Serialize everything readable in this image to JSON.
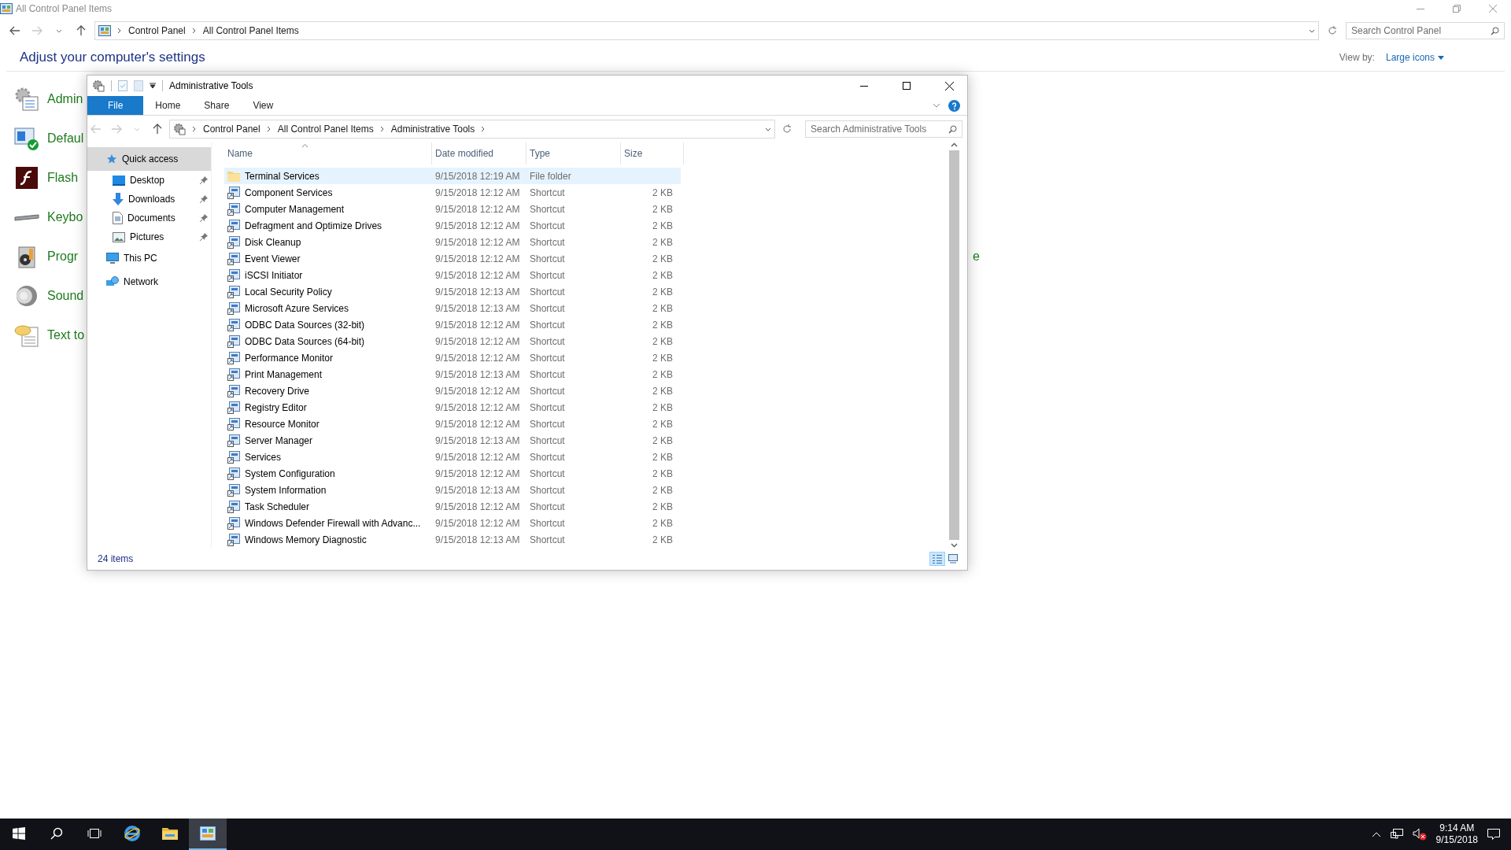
{
  "background_window": {
    "title": "All Control Panel Items",
    "breadcrumb": [
      "Control Panel",
      "All Control Panel Items"
    ],
    "search": {
      "placeholder": "Search Control Panel"
    },
    "heading": "Adjust your computer's settings",
    "view_by": {
      "label": "View by:",
      "value": "Large icons"
    },
    "items": [
      {
        "label": "Admin",
        "kind": "admin"
      },
      {
        "label": "Defaul",
        "kind": "default"
      },
      {
        "label": "Flash",
        "kind": "flash"
      },
      {
        "label": "Keybo",
        "kind": "keyboard"
      },
      {
        "label": "Progr",
        "kind": "programs"
      },
      {
        "label": "Sound",
        "kind": "sound"
      },
      {
        "label": "Text to",
        "kind": "speech"
      }
    ],
    "partial_item": "e"
  },
  "explorer": {
    "title": "Administrative Tools",
    "ribbon_tabs": [
      {
        "label": "File",
        "selected": true
      },
      {
        "label": "Home",
        "selected": false
      },
      {
        "label": "Share",
        "selected": false
      },
      {
        "label": "View",
        "selected": false
      }
    ],
    "breadcrumb": [
      "Control Panel",
      "All Control Panel Items",
      "Administrative Tools"
    ],
    "search": {
      "placeholder": "Search Administrative Tools"
    },
    "nav": [
      {
        "label": "Quick access",
        "kind": "quick_access",
        "selected": true,
        "children": [
          {
            "label": "Desktop",
            "kind": "desktop",
            "selected": false,
            "pinned": true
          },
          {
            "label": "Downloads",
            "kind": "downloads",
            "selected": false,
            "pinned": true
          },
          {
            "label": "Documents",
            "kind": "documents",
            "selected": false,
            "pinned": true
          },
          {
            "label": "Pictures",
            "kind": "pictures",
            "selected": false,
            "pinned": true
          }
        ]
      },
      {
        "label": "This PC",
        "kind": "pc",
        "selected": false
      },
      {
        "label": "Network",
        "kind": "network",
        "selected": false
      }
    ],
    "columns": [
      "Name",
      "Date modified",
      "Type",
      "Size"
    ],
    "rows": [
      {
        "name": "Terminal Services",
        "date": "9/15/2018 12:19 AM",
        "type": "File folder",
        "kind": "folder",
        "selected": true
      },
      {
        "name": "Component Services",
        "date": "9/15/2018 12:12 AM",
        "type": "Shortcut",
        "size": "2 KB",
        "kind": "shortcut",
        "selected": false
      },
      {
        "name": "Computer Management",
        "date": "9/15/2018 12:12 AM",
        "type": "Shortcut",
        "size": "2 KB",
        "kind": "shortcut",
        "selected": false
      },
      {
        "name": "Defragment and Optimize Drives",
        "date": "9/15/2018 12:12 AM",
        "type": "Shortcut",
        "size": "2 KB",
        "kind": "shortcut",
        "selected": false
      },
      {
        "name": "Disk Cleanup",
        "date": "9/15/2018 12:12 AM",
        "type": "Shortcut",
        "size": "2 KB",
        "kind": "shortcut",
        "selected": false
      },
      {
        "name": "Event Viewer",
        "date": "9/15/2018 12:12 AM",
        "type": "Shortcut",
        "size": "2 KB",
        "kind": "shortcut",
        "selected": false
      },
      {
        "name": "iSCSI Initiator",
        "date": "9/15/2018 12:12 AM",
        "type": "Shortcut",
        "size": "2 KB",
        "kind": "shortcut",
        "selected": false
      },
      {
        "name": "Local Security Policy",
        "date": "9/15/2018 12:13 AM",
        "type": "Shortcut",
        "size": "2 KB",
        "kind": "shortcut",
        "selected": false
      },
      {
        "name": "Microsoft Azure Services",
        "date": "9/15/2018 12:13 AM",
        "type": "Shortcut",
        "size": "2 KB",
        "kind": "shortcut",
        "selected": false
      },
      {
        "name": "ODBC Data Sources (32-bit)",
        "date": "9/15/2018 12:12 AM",
        "type": "Shortcut",
        "size": "2 KB",
        "kind": "shortcut",
        "selected": false
      },
      {
        "name": "ODBC Data Sources (64-bit)",
        "date": "9/15/2018 12:12 AM",
        "type": "Shortcut",
        "size": "2 KB",
        "kind": "shortcut",
        "selected": false
      },
      {
        "name": "Performance Monitor",
        "date": "9/15/2018 12:12 AM",
        "type": "Shortcut",
        "size": "2 KB",
        "kind": "shortcut",
        "selected": false
      },
      {
        "name": "Print Management",
        "date": "9/15/2018 12:13 AM",
        "type": "Shortcut",
        "size": "2 KB",
        "kind": "shortcut",
        "selected": false
      },
      {
        "name": "Recovery Drive",
        "date": "9/15/2018 12:12 AM",
        "type": "Shortcut",
        "size": "2 KB",
        "kind": "shortcut",
        "selected": false
      },
      {
        "name": "Registry Editor",
        "date": "9/15/2018 12:12 AM",
        "type": "Shortcut",
        "size": "2 KB",
        "kind": "shortcut",
        "selected": false
      },
      {
        "name": "Resource Monitor",
        "date": "9/15/2018 12:12 AM",
        "type": "Shortcut",
        "size": "2 KB",
        "kind": "shortcut",
        "selected": false
      },
      {
        "name": "Server Manager",
        "date": "9/15/2018 12:13 AM",
        "type": "Shortcut",
        "size": "2 KB",
        "kind": "shortcut",
        "selected": false
      },
      {
        "name": "Services",
        "date": "9/15/2018 12:12 AM",
        "type": "Shortcut",
        "size": "2 KB",
        "kind": "shortcut",
        "selected": false
      },
      {
        "name": "System Configuration",
        "date": "9/15/2018 12:12 AM",
        "type": "Shortcut",
        "size": "2 KB",
        "kind": "shortcut",
        "selected": false
      },
      {
        "name": "System Information",
        "date": "9/15/2018 12:13 AM",
        "type": "Shortcut",
        "size": "2 KB",
        "kind": "shortcut",
        "selected": false
      },
      {
        "name": "Task Scheduler",
        "date": "9/15/2018 12:12 AM",
        "type": "Shortcut",
        "size": "2 KB",
        "kind": "shortcut",
        "selected": false
      },
      {
        "name": "Windows Defender Firewall with Advanc...",
        "date": "9/15/2018 12:12 AM",
        "type": "Shortcut",
        "size": "2 KB",
        "kind": "shortcut",
        "selected": false
      },
      {
        "name": "Windows Memory Diagnostic",
        "date": "9/15/2018 12:13 AM",
        "type": "Shortcut",
        "size": "2 KB",
        "kind": "shortcut",
        "selected": false
      }
    ],
    "status": "24 items",
    "views": [
      {
        "kind": "details",
        "selected": true
      },
      {
        "kind": "large_icons",
        "selected": false
      }
    ]
  },
  "taskbar": {
    "buttons": [
      {
        "kind": "start",
        "selected": false
      },
      {
        "kind": "search",
        "selected": false
      },
      {
        "kind": "task_view",
        "selected": false
      },
      {
        "kind": "browser",
        "selected": false
      },
      {
        "kind": "explorer",
        "selected": false
      },
      {
        "kind": "control_panel",
        "selected": true
      }
    ],
    "time": "9:14 AM",
    "date": "9/15/2018"
  }
}
